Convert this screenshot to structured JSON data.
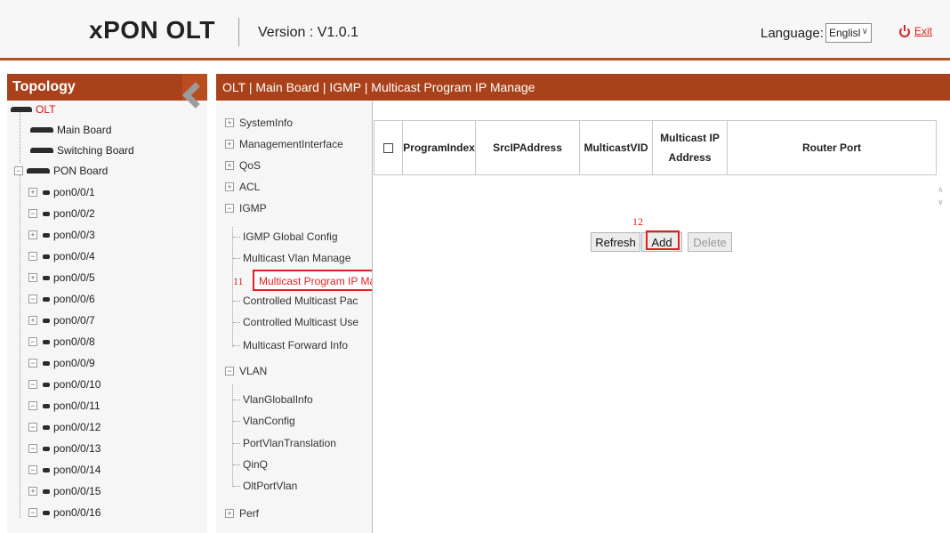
{
  "header": {
    "brand": "xPON OLT",
    "version": "Version : V1.0.1",
    "language_label": "Language:",
    "language_value": "Englisl",
    "exit_label": "Exit"
  },
  "topology": {
    "title": "Topology",
    "root": "OLT",
    "boards": [
      "Main Board",
      "Switching Board",
      "PON Board"
    ],
    "ports": [
      "pon0/0/1",
      "pon0/0/2",
      "pon0/0/3",
      "pon0/0/4",
      "pon0/0/5",
      "pon0/0/6",
      "pon0/0/7",
      "pon0/0/8",
      "pon0/0/9",
      "pon0/0/10",
      "pon0/0/11",
      "pon0/0/12",
      "pon0/0/13",
      "pon0/0/14",
      "pon0/0/15",
      "pon0/0/16"
    ]
  },
  "breadcrumb": "OLT | Main Board | IGMP | Multicast Program IP Manage",
  "menu": {
    "systeminfo": "SystemInfo",
    "management": "ManagementInterface",
    "qos": "QoS",
    "acl": "ACL",
    "igmp": "IGMP",
    "igmp_children": [
      "IGMP Global Config",
      "Multicast Vlan Manage",
      "Multicast Program IP Ma",
      "Controlled Multicast Pac",
      "Controlled Multicast Use",
      "Multicast Forward Info"
    ],
    "vlan": "VLAN",
    "vlan_children": [
      "VlanGlobalInfo",
      "VlanConfig",
      "PortVlanTranslation",
      "QinQ",
      "OltPortVlan"
    ],
    "perf": "Perf",
    "callout": "11"
  },
  "table": {
    "columns": [
      "ProgramIndex",
      "SrcIPAddress",
      "MulticastVID",
      "Multicast IP Address",
      "Router Port"
    ]
  },
  "actions": {
    "refresh": "Refresh",
    "add": "Add",
    "delete": "Delete",
    "callout": "12"
  }
}
